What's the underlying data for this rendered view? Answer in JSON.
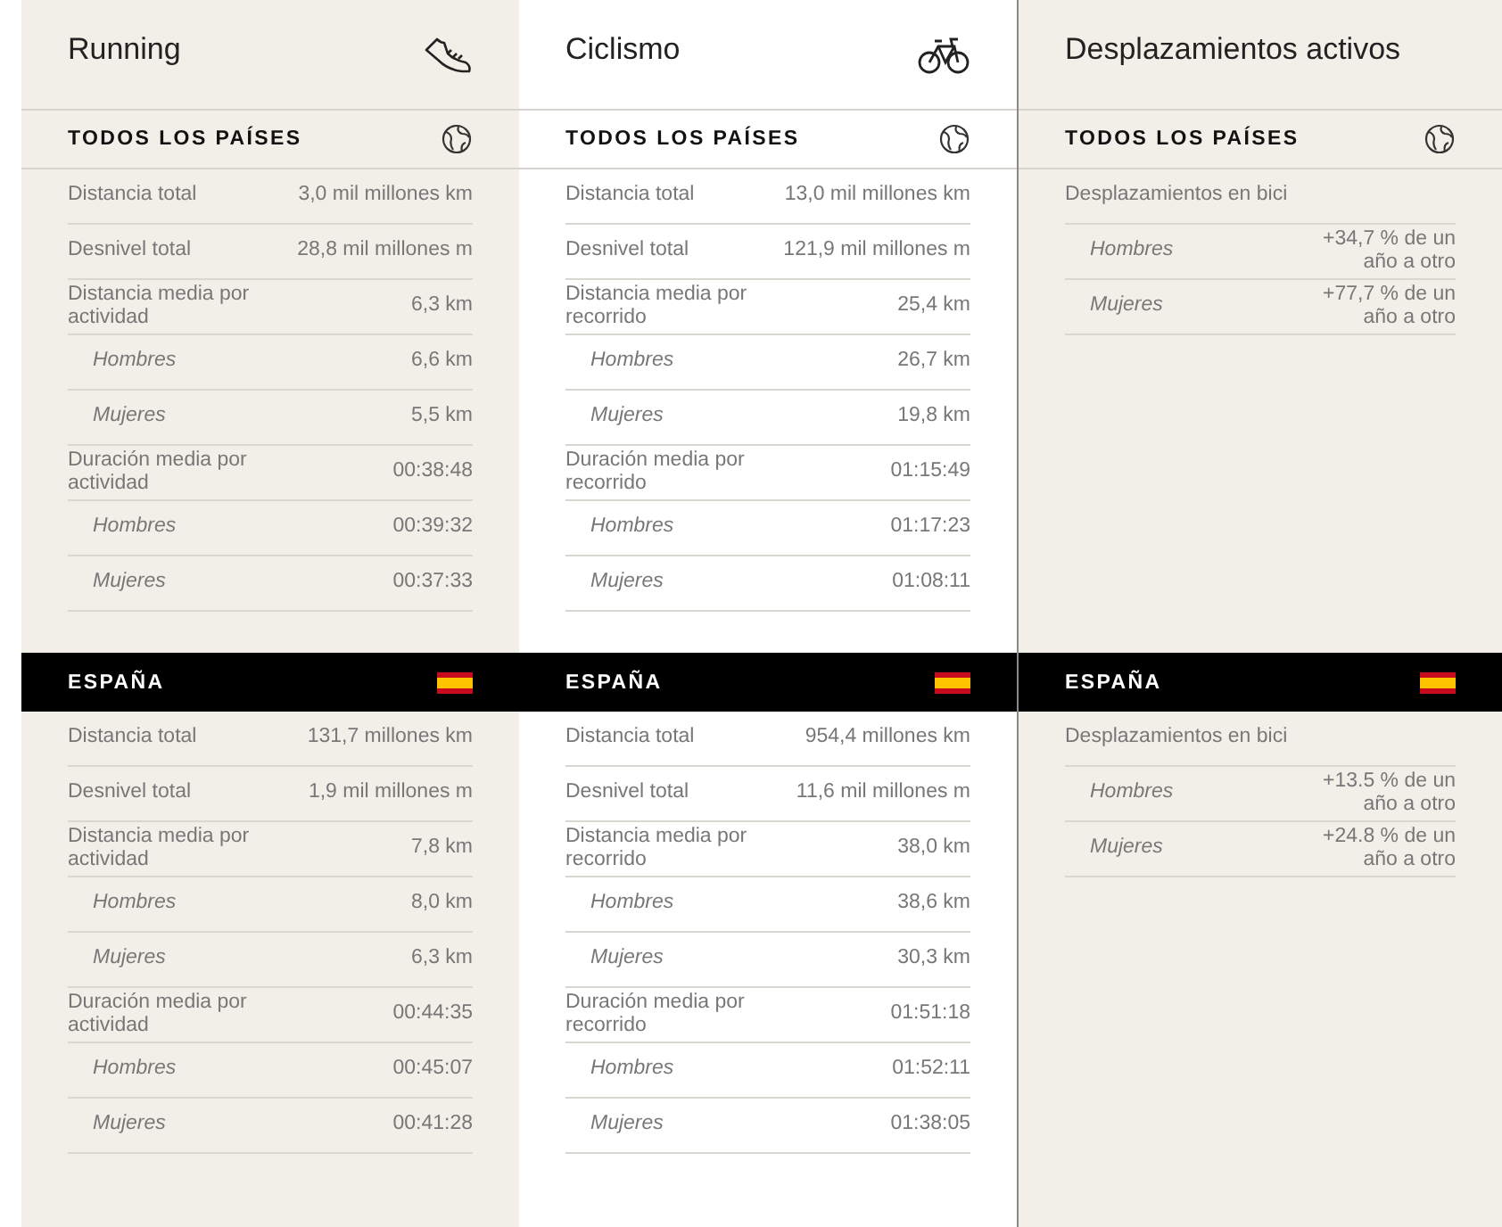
{
  "columns": [
    {
      "title": "Running",
      "sections": [
        {
          "kind": "global",
          "heading": "TODOS LOS PAÍSES",
          "rows": [
            {
              "kind": "main",
              "label": "Distancia total",
              "value": "3,0 mil millones km"
            },
            {
              "kind": "main",
              "label": "Desnivel total",
              "value": "28,8 mil millones m"
            },
            {
              "kind": "main",
              "label": "Distancia media por actividad",
              "value": "6,3 km"
            },
            {
              "kind": "sub",
              "label": "Hombres",
              "value": "6,6 km"
            },
            {
              "kind": "sub",
              "label": "Mujeres",
              "value": "5,5 km"
            },
            {
              "kind": "main",
              "label": "Duración media por actividad",
              "value": "00:38:48"
            },
            {
              "kind": "sub",
              "label": "Hombres",
              "value": "00:39:32"
            },
            {
              "kind": "sub",
              "label": "Mujeres",
              "value": "00:37:33"
            }
          ]
        },
        {
          "kind": "country",
          "heading": "ESPAÑA",
          "rows": [
            {
              "kind": "main",
              "label": "Distancia total",
              "value": "131,7 millones km"
            },
            {
              "kind": "main",
              "label": "Desnivel total",
              "value": "1,9 mil millones m"
            },
            {
              "kind": "main",
              "label": "Distancia media por actividad",
              "value": "7,8 km"
            },
            {
              "kind": "sub",
              "label": "Hombres",
              "value": "8,0 km"
            },
            {
              "kind": "sub",
              "label": "Mujeres",
              "value": "6,3 km"
            },
            {
              "kind": "main",
              "label": "Duración media por actividad",
              "value": "00:44:35"
            },
            {
              "kind": "sub",
              "label": "Hombres",
              "value": "00:45:07"
            },
            {
              "kind": "sub",
              "label": "Mujeres",
              "value": "00:41:28"
            }
          ]
        }
      ]
    },
    {
      "title": "Ciclismo",
      "sections": [
        {
          "kind": "global",
          "heading": "TODOS LOS PAÍSES",
          "rows": [
            {
              "kind": "main",
              "label": "Distancia total",
              "value": "13,0 mil millones km"
            },
            {
              "kind": "main",
              "label": "Desnivel total",
              "value": "121,9 mil millones m"
            },
            {
              "kind": "main",
              "label": "Distancia media por recorrido",
              "value": "25,4 km"
            },
            {
              "kind": "sub",
              "label": "Hombres",
              "value": "26,7 km"
            },
            {
              "kind": "sub",
              "label": "Mujeres",
              "value": "19,8 km"
            },
            {
              "kind": "main",
              "label": "Duración media por recorrido",
              "value": "01:15:49"
            },
            {
              "kind": "sub",
              "label": "Hombres",
              "value": "01:17:23"
            },
            {
              "kind": "sub",
              "label": "Mujeres",
              "value": "01:08:11"
            }
          ]
        },
        {
          "kind": "country",
          "heading": "ESPAÑA",
          "rows": [
            {
              "kind": "main",
              "label": "Distancia total",
              "value": "954,4 millones km"
            },
            {
              "kind": "main",
              "label": "Desnivel total",
              "value": "11,6 mil millones m"
            },
            {
              "kind": "main",
              "label": "Distancia media por recorrido",
              "value": "38,0 km"
            },
            {
              "kind": "sub",
              "label": "Hombres",
              "value": "38,6 km"
            },
            {
              "kind": "sub",
              "label": "Mujeres",
              "value": "30,3 km"
            },
            {
              "kind": "main",
              "label": "Duración media por recorrido",
              "value": "01:51:18"
            },
            {
              "kind": "sub",
              "label": "Hombres",
              "value": "01:52:11"
            },
            {
              "kind": "sub",
              "label": "Mujeres",
              "value": "01:38:05"
            }
          ]
        }
      ]
    },
    {
      "title": "Desplazamientos activos",
      "sections": [
        {
          "kind": "global",
          "heading": "TODOS LOS PAÍSES",
          "rows": [
            {
              "kind": "group",
              "label": "Desplazamientos en bici"
            },
            {
              "kind": "sub",
              "label": "Hombres",
              "value": "+34,7 % de un año a otro"
            },
            {
              "kind": "sub",
              "label": "Mujeres",
              "value": "+77,7 % de un año a otro"
            }
          ]
        },
        {
          "kind": "country",
          "heading": "ESPAÑA",
          "rows": [
            {
              "kind": "group",
              "label": "Desplazamientos en bici"
            },
            {
              "kind": "sub",
              "label": "Hombres",
              "value": "+13.5 % de un año a otro"
            },
            {
              "kind": "sub",
              "label": "Mujeres",
              "value": "+24.8 % de un año a otro"
            }
          ]
        }
      ]
    }
  ]
}
